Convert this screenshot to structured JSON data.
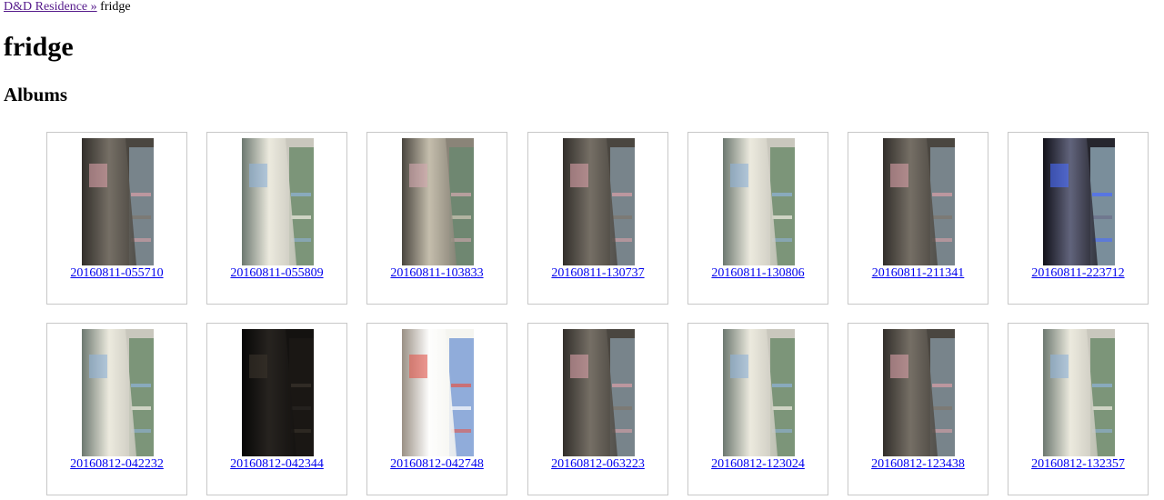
{
  "breadcrumb": {
    "parent_label": "D&D Residence »",
    "current_label": "fridge"
  },
  "page_title": "fridge",
  "section_title": "Albums",
  "colors": {
    "visited_link": "#551a8b",
    "link": "#0000ee",
    "card_border": "#c8c8c8"
  },
  "albums": [
    {
      "label": "20160811-055710",
      "tone": "dark"
    },
    {
      "label": "20160811-055809",
      "tone": "light"
    },
    {
      "label": "20160811-103833",
      "tone": "mid"
    },
    {
      "label": "20160811-130737",
      "tone": "dark"
    },
    {
      "label": "20160811-130806",
      "tone": "light"
    },
    {
      "label": "20160811-211341",
      "tone": "dark"
    },
    {
      "label": "20160811-223712",
      "tone": "blue"
    },
    {
      "label": "20160812-042232",
      "tone": "light"
    },
    {
      "label": "20160812-042344",
      "tone": "black"
    },
    {
      "label": "20160812-042748",
      "tone": "bright"
    },
    {
      "label": "20160812-063223",
      "tone": "dark"
    },
    {
      "label": "20160812-123024",
      "tone": "light"
    },
    {
      "label": "20160812-123438",
      "tone": "dark"
    },
    {
      "label": "20160812-132357",
      "tone": "light"
    }
  ]
}
